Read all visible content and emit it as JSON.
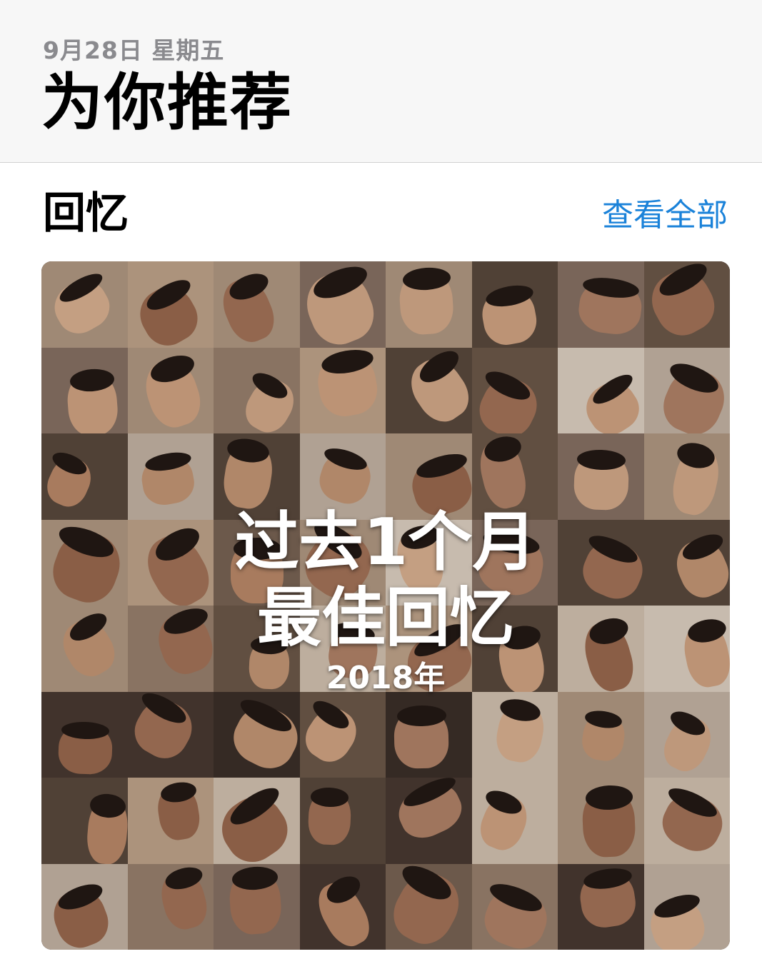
{
  "header": {
    "date": "9月28日 星期五",
    "title": "为你推荐"
  },
  "memories_section": {
    "title": "回忆",
    "see_all_label": "查看全部"
  },
  "memory_card": {
    "title_line1": "过去1个月",
    "title_line2": "最佳回忆",
    "year": "2018年",
    "grid": {
      "columns": 8,
      "rows": 8
    }
  },
  "colors": {
    "accent": "#1a82d9",
    "header_bg": "#f7f7f7",
    "secondary_text": "#8a8a8e"
  }
}
